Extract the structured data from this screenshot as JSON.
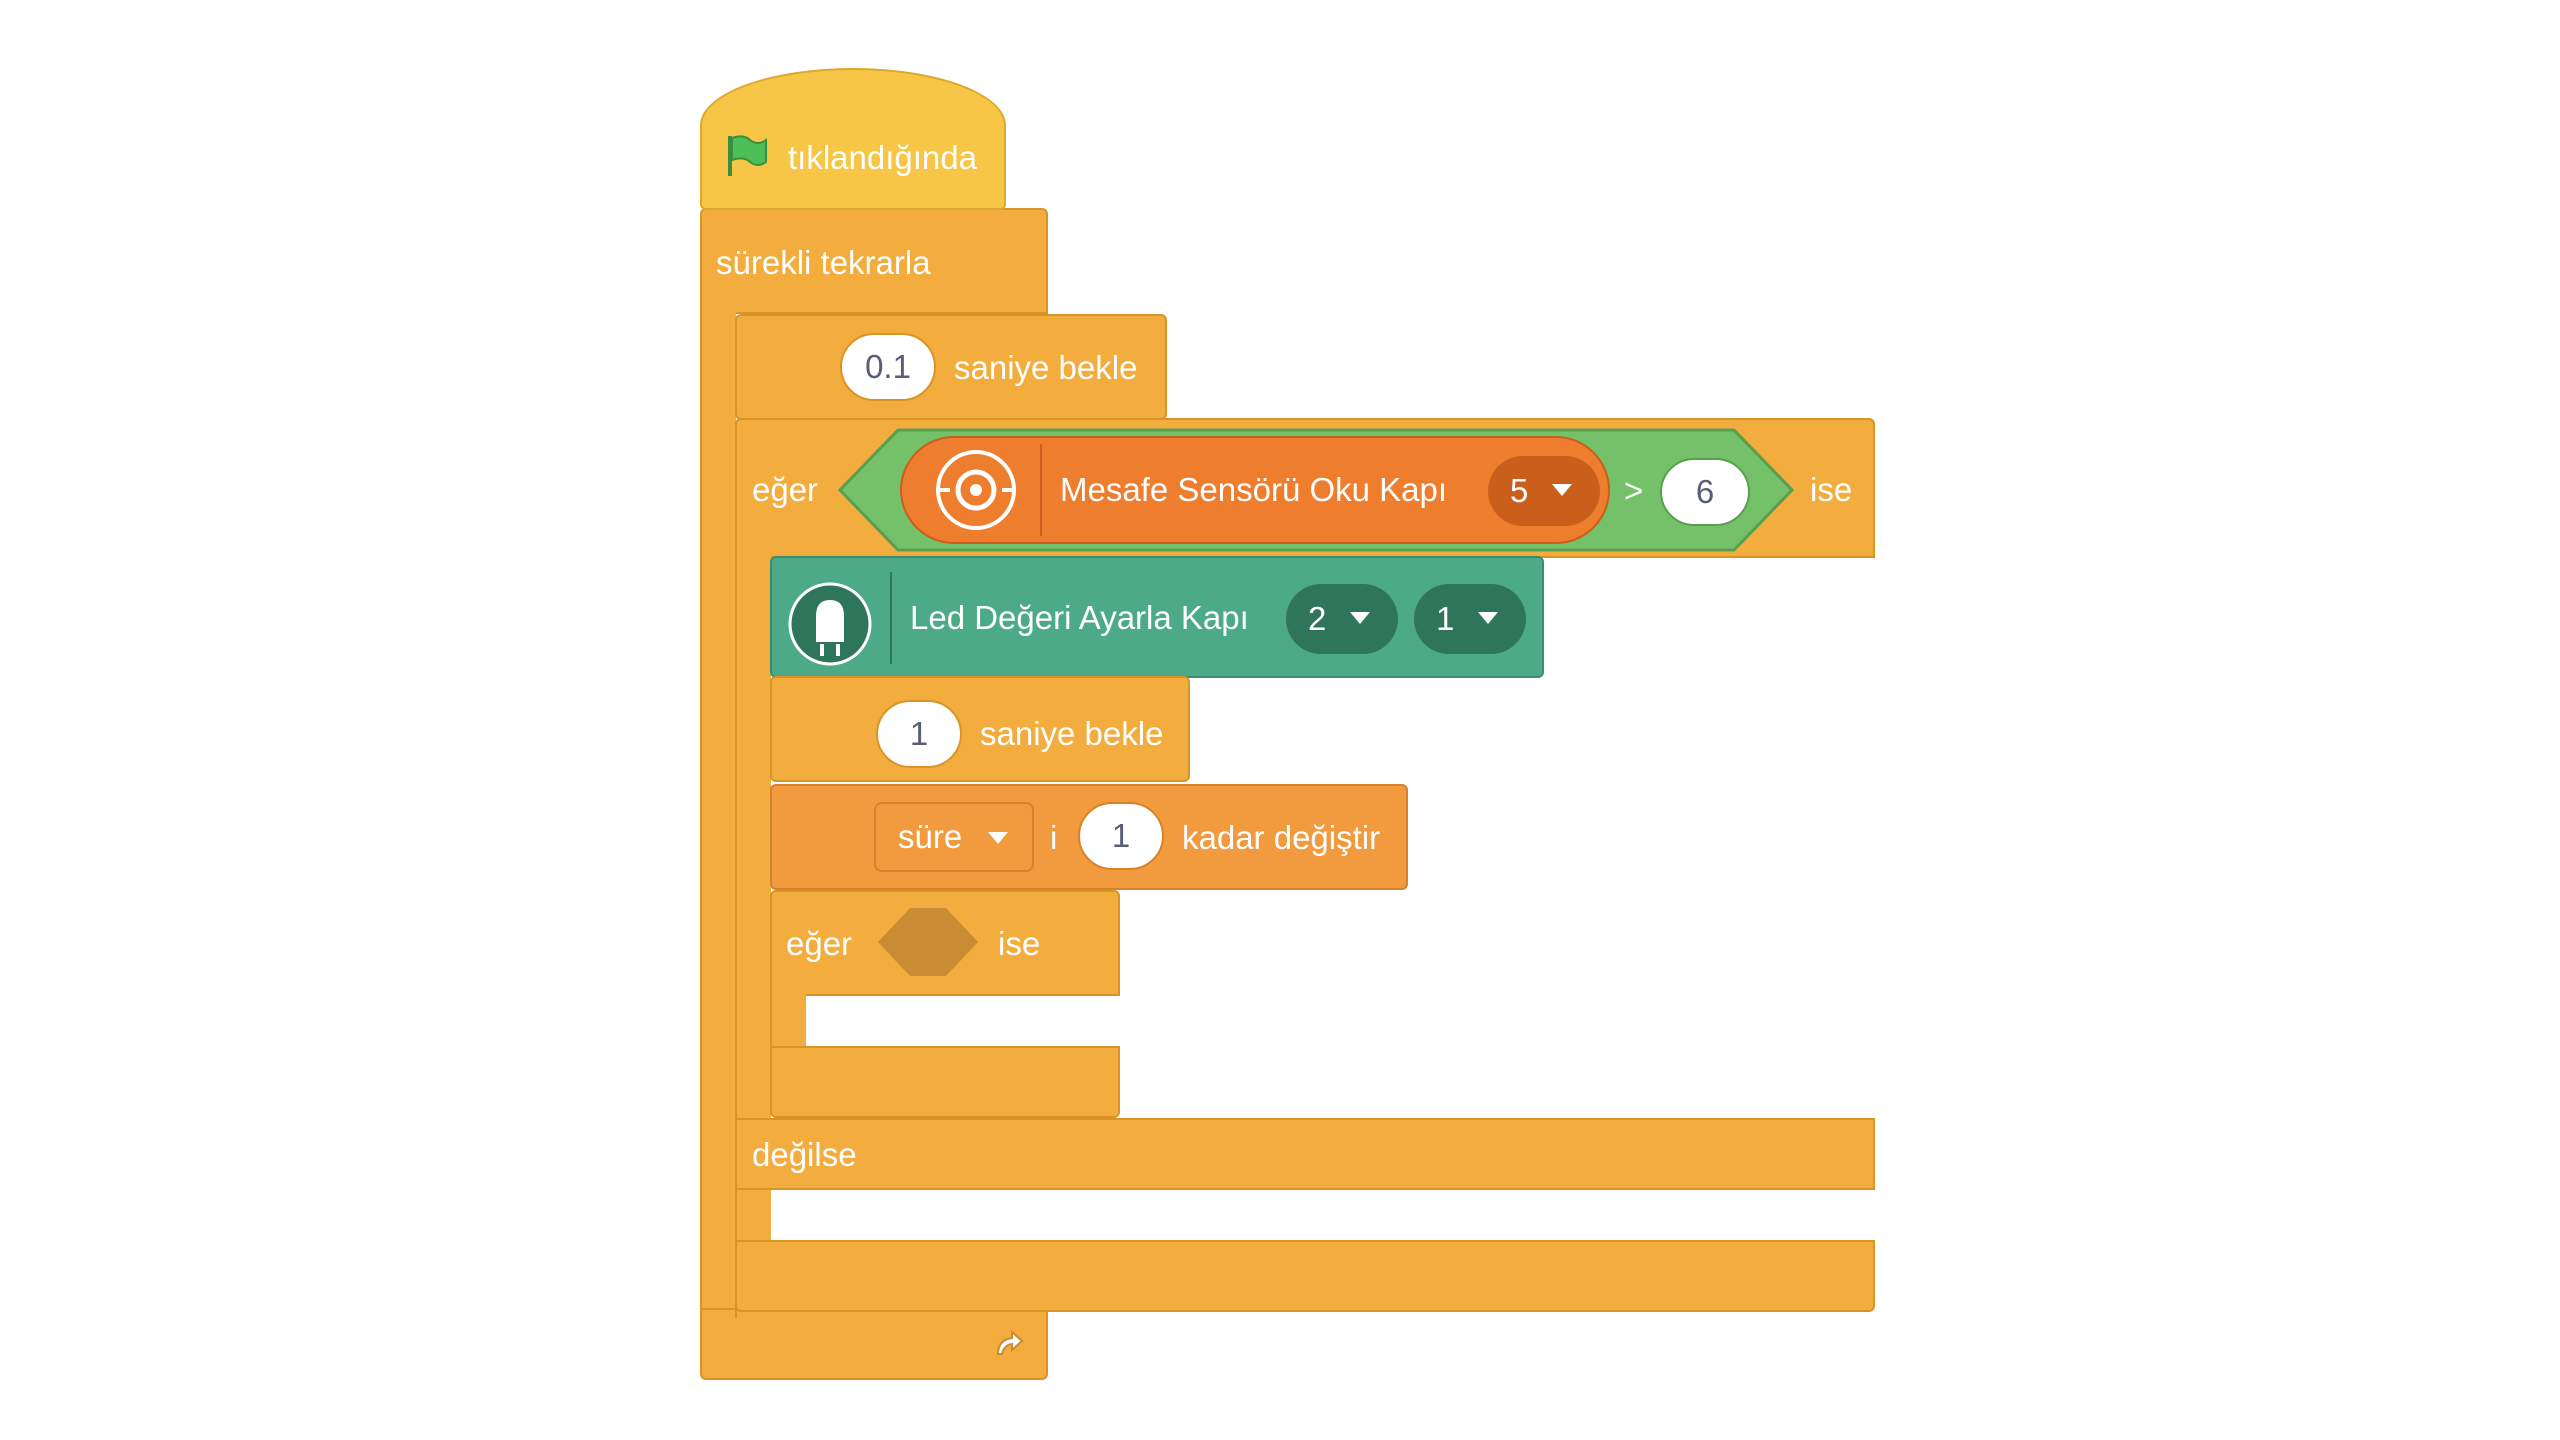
{
  "colors": {
    "control": "#f3ad3e",
    "control_border": "#d99426",
    "operator": "#74c169",
    "sensor": "#ef7d2e",
    "sensor_dark": "#c95f1b",
    "led": "#4daa88",
    "led_dark": "#2f7559",
    "variable": "#f19a3e",
    "empty_slot": "#c98c35",
    "flag": "#4cbf56"
  },
  "hat": {
    "flag_icon": "green-flag-icon",
    "label": "tıklandığında"
  },
  "forever": {
    "label": "sürekli tekrarla",
    "loop_icon": "loop-arrow-icon"
  },
  "wait1": {
    "value": "0.1",
    "label": "saniye bekle"
  },
  "if1": {
    "label": "eğer",
    "then_label": "ise",
    "sensor": {
      "icon": "distance-sensor-icon",
      "label": "Mesafe Sensörü Oku Kapı",
      "port": "5"
    },
    "operator": ">",
    "compare_value": "6"
  },
  "led": {
    "icon": "led-icon",
    "label": "Led Değeri Ayarla Kapı",
    "port": "2",
    "value": "1"
  },
  "wait2": {
    "value": "1",
    "label": "saniye bekle"
  },
  "change_var": {
    "variable": "süre",
    "suffix": "i",
    "value": "1",
    "label": "kadar değiştir"
  },
  "if2": {
    "label": "eğer",
    "then_label": "ise"
  },
  "else_label": "değilse"
}
